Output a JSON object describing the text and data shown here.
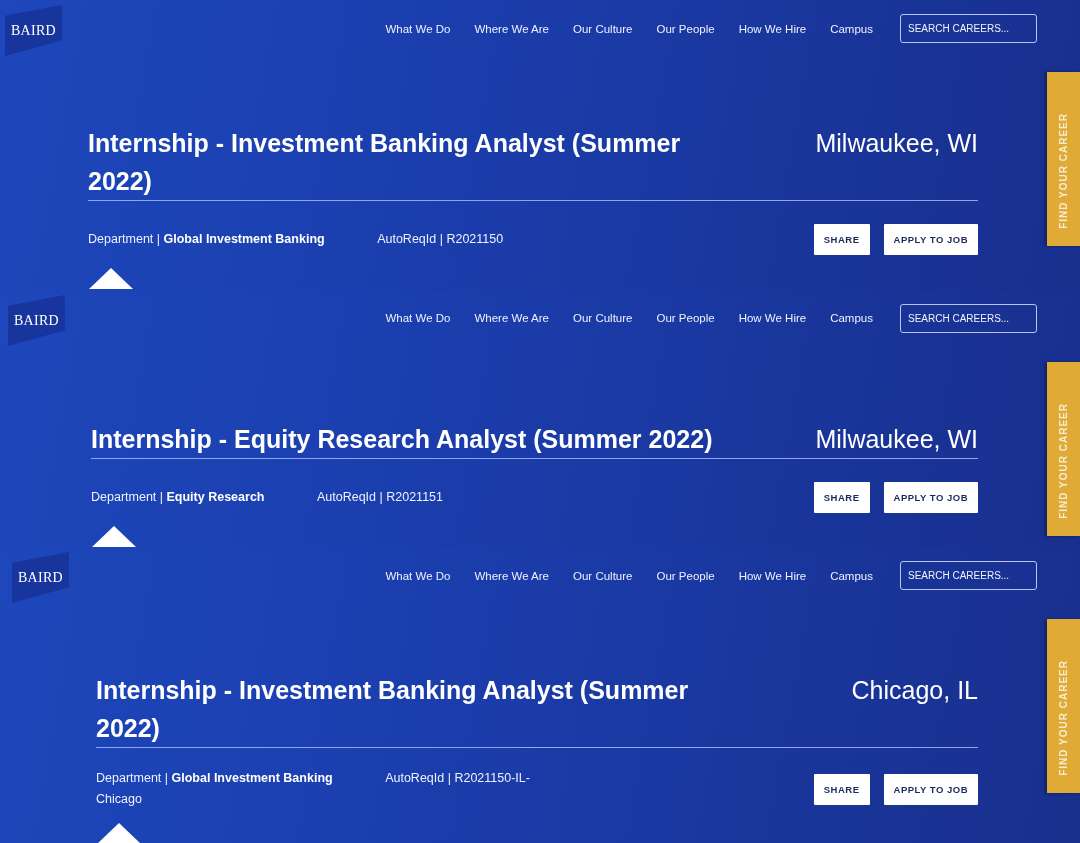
{
  "panels": [
    {
      "logo": "BAIRD",
      "nav": [
        "What We Do",
        "Where We Are",
        "Our Culture",
        "Our People",
        "How We Hire",
        "Campus"
      ],
      "search": {
        "placeholder": "SEARCH CAREERS..."
      },
      "job": {
        "title": "Internship - Investment Banking Analyst (Summer 2022)",
        "location": "Milwaukee, WI",
        "department": "Department | **Global Investment Banking**",
        "req_id": "AutoReqId | R2021150"
      },
      "buttons": [
        "SHARE",
        "APPLY TO JOB"
      ],
      "side_tab": "FIND YOUR CAREER"
    },
    {
      "logo": "BAIRD",
      "nav": [
        "What We Do",
        "Where We Are",
        "Our Culture",
        "Our People",
        "How We Hire",
        "Campus"
      ],
      "search": {
        "placeholder": "SEARCH CAREERS..."
      },
      "job": {
        "title": "Internship - Equity Research Analyst (Summer 2022)",
        "location": "Milwaukee, WI",
        "department": "Department | **Equity Research**",
        "req_id": "AutoReqId | R2021151"
      },
      "buttons": [
        "SHARE",
        "APPLY TO JOB"
      ],
      "side_tab": "FIND YOUR CAREER"
    },
    {
      "logo": "BAIRD",
      "nav": [
        "What We Do",
        "Where We Are",
        "Our Culture",
        "Our People",
        "How We Hire",
        "Campus"
      ],
      "search": {
        "placeholder": "SEARCH CAREERS..."
      },
      "job": {
        "title": "Internship - Investment Banking Analyst (Summer 2022)",
        "location": "Chicago, IL",
        "department": "Department | **Global Investment Banking**",
        "req_id": "AutoReqId | R2021150-IL-Chicago"
      },
      "buttons": [
        "SHARE",
        "APPLY TO JOB"
      ],
      "side_tab": "FIND YOUR CAREER"
    }
  ]
}
